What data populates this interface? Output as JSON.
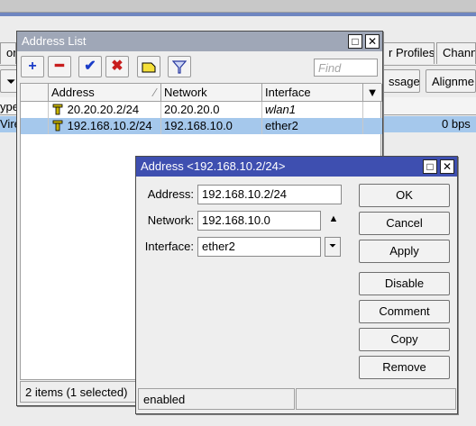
{
  "background": {
    "tab_partial_left": "on",
    "tab_profiles": "r Profiles",
    "tab_channels": "Chann",
    "btn_message": "ssage",
    "btn_alignment": "Alignme",
    "col_type_partial": "ype",
    "row_type_partial": "Vire",
    "row_rate": "0 bps"
  },
  "address_list": {
    "title": "Address List",
    "toolbar": {
      "add_icon": "plus-icon",
      "remove_icon": "minus-icon",
      "enable_icon": "check-icon",
      "disable_icon": "x-icon",
      "comment_icon": "note-icon",
      "filter_icon": "filter-icon",
      "find_placeholder": "Find"
    },
    "columns": [
      "Address",
      "Network",
      "Interface"
    ],
    "rows": [
      {
        "address": "20.20.20.2/24",
        "network": "20.20.20.0",
        "interface": "wlan1",
        "selected": false
      },
      {
        "address": "192.168.10.2/24",
        "network": "192.168.10.0",
        "interface": "ether2",
        "selected": true
      }
    ],
    "status": "2 items (1 selected)"
  },
  "dialog": {
    "title": "Address <192.168.10.2/24>",
    "labels": {
      "address": "Address:",
      "network": "Network:",
      "interface": "Interface:"
    },
    "values": {
      "address": "192.168.10.2/24",
      "network": "192.168.10.0",
      "interface": "ether2"
    },
    "buttons": {
      "ok": "OK",
      "cancel": "Cancel",
      "apply": "Apply",
      "disable": "Disable",
      "comment": "Comment",
      "copy": "Copy",
      "remove": "Remove"
    },
    "status": "enabled"
  },
  "colors": {
    "dialog_title": "#3e4fb0",
    "list_title": "#9fa7b7",
    "selection": "#a5c8ec",
    "add": "#1a3cc8",
    "remove": "#c81e1e"
  }
}
